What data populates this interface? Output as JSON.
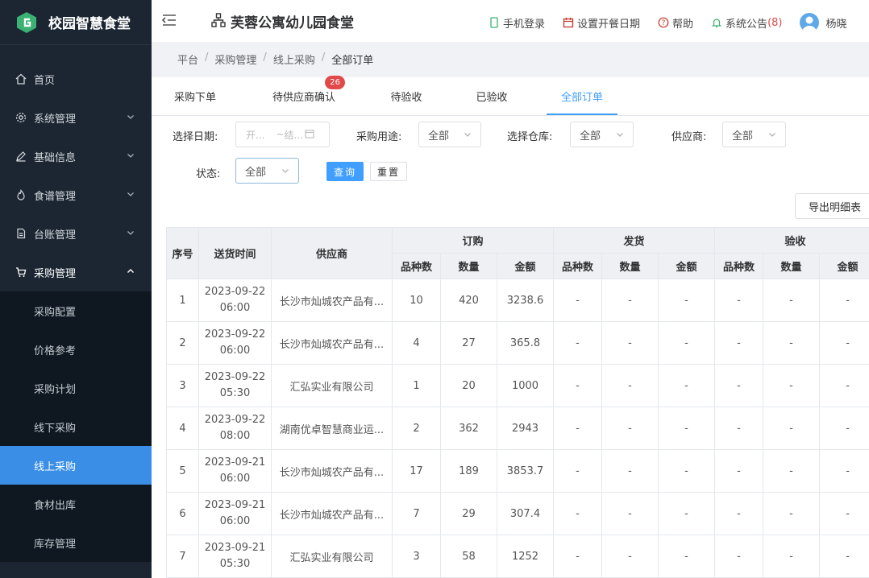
{
  "app": {
    "title": "校园智慧食堂",
    "org_title": "芙蓉公寓幼儿园食堂"
  },
  "header": {
    "links": [
      {
        "label": "手机登录",
        "icon": "mobile-icon"
      },
      {
        "label": "设置开餐日期",
        "icon": "calendar-icon"
      },
      {
        "label": "帮助",
        "icon": "help-icon"
      }
    ],
    "notice_label": "系统公告",
    "notice_count": "(8)",
    "user_name": "杨晓"
  },
  "sidebar": {
    "items": [
      {
        "label": "首页",
        "icon": "home-icon"
      },
      {
        "label": "系统管理",
        "icon": "gear-icon"
      },
      {
        "label": "基础信息",
        "icon": "edit-icon"
      },
      {
        "label": "食谱管理",
        "icon": "flame-icon"
      },
      {
        "label": "台账管理",
        "icon": "document-icon"
      },
      {
        "label": "采购管理",
        "icon": "cart-icon"
      }
    ],
    "sub_items": [
      "采购配置",
      "价格参考",
      "采购计划",
      "线下采购",
      "线上采购",
      "食材出库",
      "库存管理"
    ],
    "active_sub": "线上采购"
  },
  "breadcrumb": [
    "平台",
    "采购管理",
    "线上采购",
    "全部订单"
  ],
  "tabs": [
    {
      "label": "采购下单"
    },
    {
      "label": "待供应商确认",
      "badge": "26"
    },
    {
      "label": "待验收"
    },
    {
      "label": "已验收"
    },
    {
      "label": "全部订单"
    }
  ],
  "filters": {
    "date_label": "选择日期:",
    "date_start_placeholder": "开...",
    "date_sep": "~",
    "date_end_placeholder": "结...",
    "purpose_label": "采购用途:",
    "purpose_value": "全部",
    "warehouse_label": "选择仓库:",
    "warehouse_value": "全部",
    "supplier_label": "供应商:",
    "supplier_value": "全部",
    "status_label": "状态:",
    "status_value": "全部",
    "query_button": "查询",
    "reset_button": "重置",
    "export_button": "导出明细表"
  },
  "table": {
    "headers": {
      "index": "序号",
      "time": "送货时间",
      "supplier": "供应商",
      "order_group": "订购",
      "ship_group": "发货",
      "check_group": "验收",
      "kinds": "品种数",
      "qty": "数量",
      "amount": "金额"
    },
    "rows": [
      {
        "no": "1",
        "date": "2023-09-22",
        "time": "06:00",
        "supplier": "长沙市灿城农产品有...",
        "kinds": "10",
        "qty": "420",
        "amount": "3238.6",
        "ship_kinds": "-",
        "ship_qty": "-",
        "ship_amount": "-",
        "check_kinds": "-",
        "check_qty": "-",
        "check_amount": "-"
      },
      {
        "no": "2",
        "date": "2023-09-22",
        "time": "06:00",
        "supplier": "长沙市灿城农产品有...",
        "kinds": "4",
        "qty": "27",
        "amount": "365.8",
        "ship_kinds": "-",
        "ship_qty": "-",
        "ship_amount": "-",
        "check_kinds": "-",
        "check_qty": "-",
        "check_amount": "-"
      },
      {
        "no": "3",
        "date": "2023-09-22",
        "time": "05:30",
        "supplier": "汇弘实业有限公司",
        "kinds": "1",
        "qty": "20",
        "amount": "1000",
        "ship_kinds": "-",
        "ship_qty": "-",
        "ship_amount": "-",
        "check_kinds": "-",
        "check_qty": "-",
        "check_amount": "-"
      },
      {
        "no": "4",
        "date": "2023-09-22",
        "time": "08:00",
        "supplier": "湖南优卓智慧商业运...",
        "kinds": "2",
        "qty": "362",
        "amount": "2943",
        "ship_kinds": "-",
        "ship_qty": "-",
        "ship_amount": "-",
        "check_kinds": "-",
        "check_qty": "-",
        "check_amount": "-"
      },
      {
        "no": "5",
        "date": "2023-09-21",
        "time": "06:00",
        "supplier": "长沙市灿城农产品有...",
        "kinds": "17",
        "qty": "189",
        "amount": "3853.7",
        "ship_kinds": "-",
        "ship_qty": "-",
        "ship_amount": "-",
        "check_kinds": "-",
        "check_qty": "-",
        "check_amount": "-"
      },
      {
        "no": "6",
        "date": "2023-09-21",
        "time": "06:00",
        "supplier": "长沙市灿城农产品有...",
        "kinds": "7",
        "qty": "29",
        "amount": "307.4",
        "ship_kinds": "-",
        "ship_qty": "-",
        "ship_amount": "-",
        "check_kinds": "-",
        "check_qty": "-",
        "check_amount": "-"
      },
      {
        "no": "7",
        "date": "2023-09-21",
        "time": "05:30",
        "supplier": "汇弘实业有限公司",
        "kinds": "3",
        "qty": "58",
        "amount": "1252",
        "ship_kinds": "-",
        "ship_qty": "-",
        "ship_amount": "-",
        "check_kinds": "-",
        "check_qty": "-",
        "check_amount": "-"
      }
    ]
  },
  "colors": {
    "sidebar_bg": "#1b2632",
    "submenu_bg": "#0f1820",
    "accent": "#409eff",
    "active_item": "#3a8ee6",
    "badge": "#e24a4a",
    "logo_green": "#3bb273"
  }
}
